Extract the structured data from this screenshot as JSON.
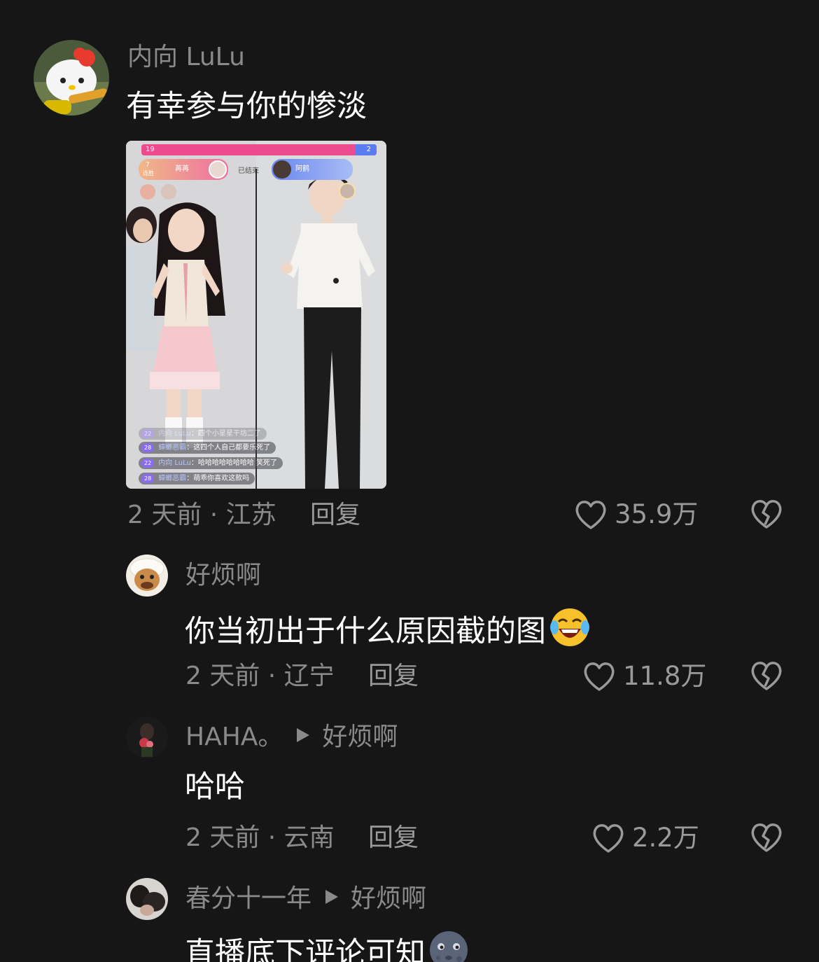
{
  "comments": [
    {
      "username": "内向 LuLu",
      "text": "有幸参与你的惨淡",
      "meta": "2 天前 · 江苏",
      "reply_label": "回复",
      "likes": "35.9万"
    },
    {
      "username": "好烦啊",
      "text": "你当初出于什么原因截的图",
      "emoji": "rolling-laughing-emoji",
      "meta": "2 天前 · 辽宁",
      "reply_label": "回复",
      "likes": "11.8万"
    },
    {
      "username": "HAHA。",
      "reply_to": "好烦啊",
      "text": "哈哈",
      "meta": "2 天前 · 云南",
      "reply_label": "回复",
      "likes": "2.2万"
    },
    {
      "username": "春分十一年",
      "reply_to": "好烦啊",
      "text": "直播底下评论可知",
      "emoji": "new-moon-face-emoji"
    }
  ],
  "screenshot": {
    "score_left": "19",
    "score_right": "2",
    "left_host": "苒苒",
    "left_count": "7",
    "left_sub": "连胜",
    "status": "已结束",
    "right_host": "阿鹤",
    "chat": [
      {
        "level": "22",
        "user": "内向 LuLu",
        "text": "四个小星星干坊二了"
      },
      {
        "level": "28",
        "user": "蟑螂恶霸",
        "text": "这四个人自己都要乐死了"
      },
      {
        "level": "22",
        "user": "内向 LuLu",
        "text": "哈哈哈哈哈哈哈哈 笑死了"
      },
      {
        "level": "28",
        "user": "蟑螂恶霸",
        "text": "萌乖你喜欢这款吗"
      }
    ]
  },
  "colors": {
    "background": "#161616",
    "secondary_text": "#8a8a8a",
    "pk_pink": "#ec4b8d",
    "pk_blue": "#5a7cf0"
  }
}
